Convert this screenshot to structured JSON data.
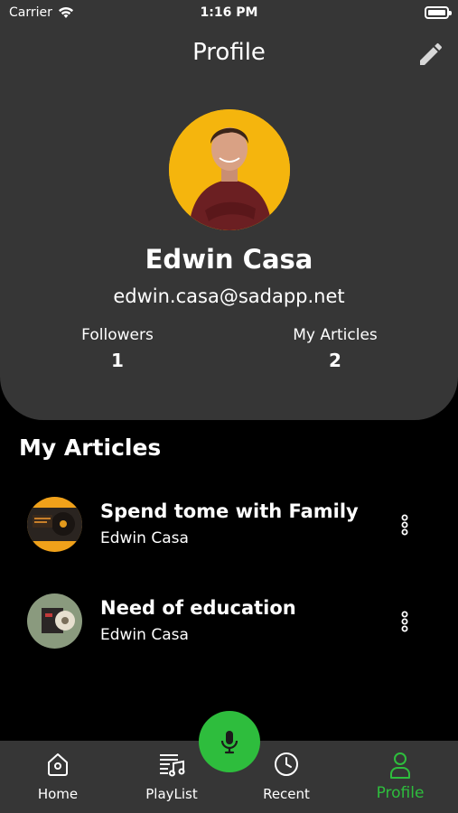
{
  "status_bar": {
    "carrier": "Carrier",
    "time": "1:16 PM"
  },
  "header": {
    "title": "Profile",
    "edit_icon": "pencil-icon"
  },
  "profile": {
    "name": "Edwin Casa",
    "email": "edwin.casa@sadapp.net",
    "stats": [
      {
        "label": "Followers",
        "value": "1"
      },
      {
        "label": "My Articles",
        "value": "2"
      }
    ]
  },
  "articles_section": {
    "title": "My Articles",
    "items": [
      {
        "title": "Spend tome with Family",
        "author": "Edwin Casa"
      },
      {
        "title": "Need of education",
        "author": "Edwin Casa"
      }
    ]
  },
  "tabbar": {
    "tabs": [
      {
        "label": "Home",
        "icon": "home-icon"
      },
      {
        "label": "PlayList",
        "icon": "playlist-icon"
      },
      {
        "label": "Recent",
        "icon": "clock-icon"
      },
      {
        "label": "Profile",
        "icon": "person-icon",
        "active": true
      }
    ],
    "mic_icon": "microphone-icon"
  },
  "colors": {
    "accent": "#2ebd3d",
    "surface": "#363636",
    "background": "#000000",
    "avatar_bg": "#f5b50d"
  }
}
